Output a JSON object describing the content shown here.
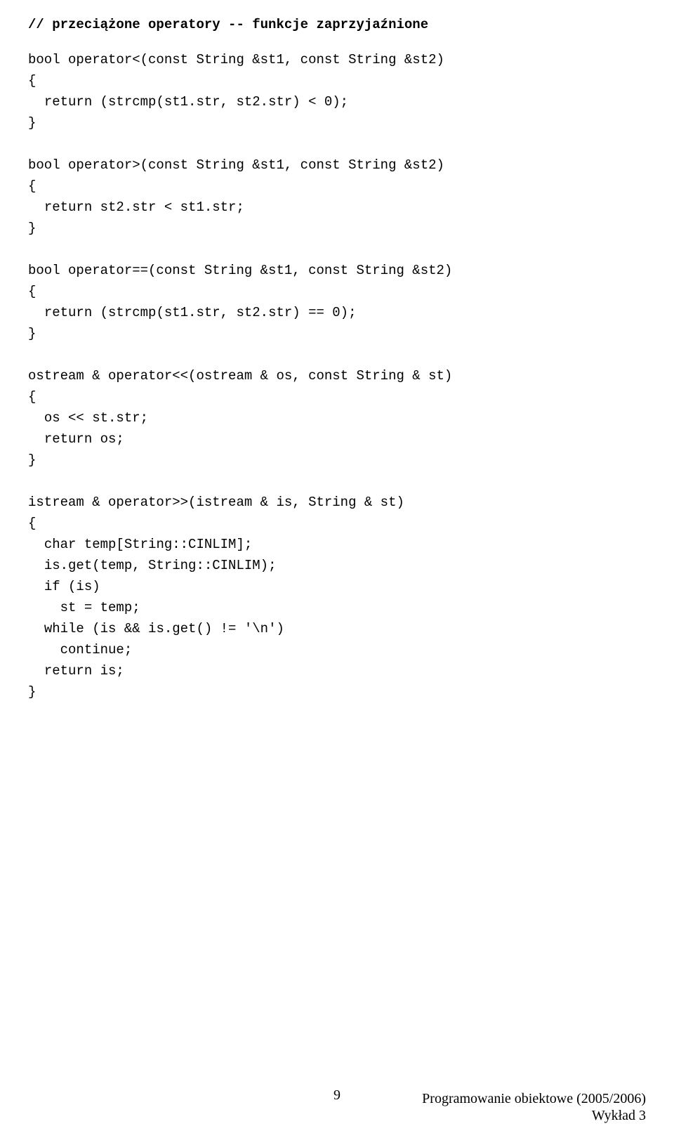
{
  "heading": "// przeciążone operatory -- funkcje zaprzyjaźnione",
  "code": "bool operator<(const String &st1, const String &st2)\n{\n  return (strcmp(st1.str, st2.str) < 0);\n}\n\nbool operator>(const String &st1, const String &st2)\n{\n  return st2.str < st1.str;\n}\n\nbool operator==(const String &st1, const String &st2)\n{\n  return (strcmp(st1.str, st2.str) == 0);\n}\n\nostream & operator<<(ostream & os, const String & st)\n{\n  os << st.str;\n  return os;\n}\n\nistream & operator>>(istream & is, String & st)\n{\n  char temp[String::CINLIM];\n  is.get(temp, String::CINLIM);\n  if (is)\n    st = temp;\n  while (is && is.get() != '\\n')\n    continue;\n  return is;\n}",
  "footer": {
    "page_num": "9",
    "line1": "Programowanie obiektowe (2005/2006)",
    "line2": "Wykład 3"
  }
}
